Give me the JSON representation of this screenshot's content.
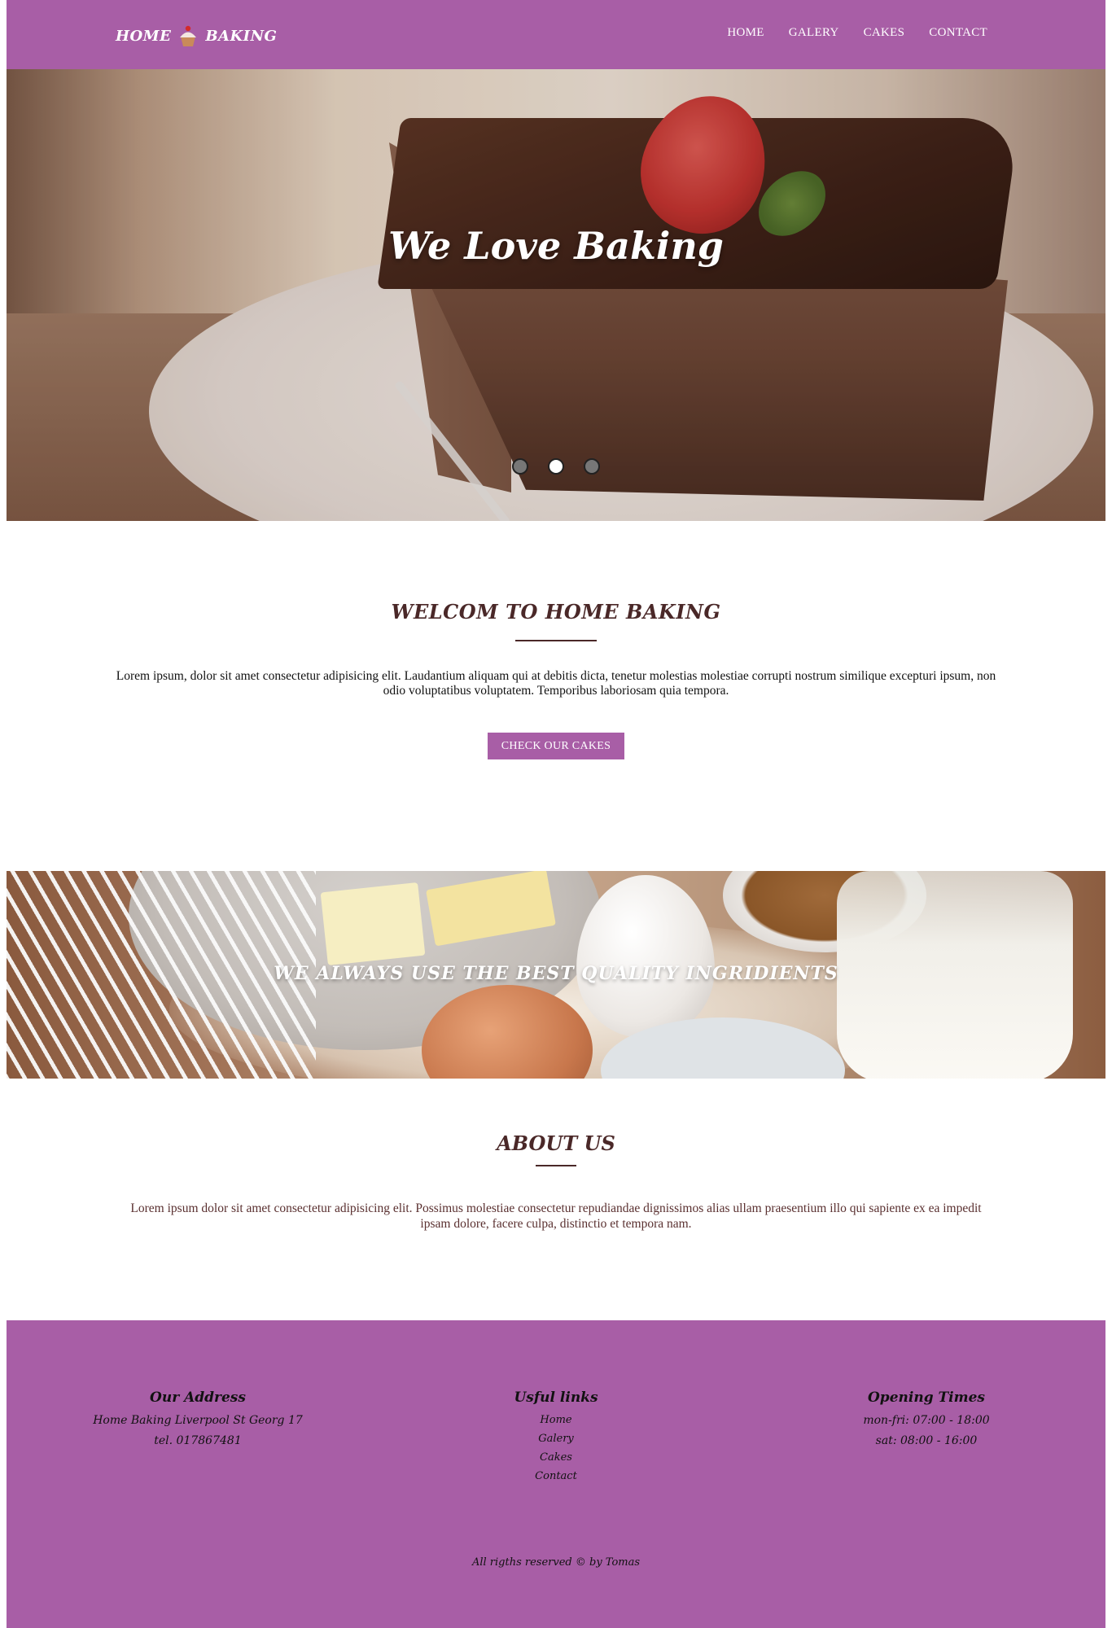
{
  "nav": {
    "logo_left": "HOME",
    "logo_right": "BAKING",
    "links": [
      "HOME",
      "GALERY",
      "CAKES",
      "CONTACT"
    ]
  },
  "hero": {
    "title": "We Love Baking",
    "slides_total": 3,
    "active_slide": 2
  },
  "welcome": {
    "title": "WELCOM TO HOME BAKING",
    "text": "Lorem ipsum, dolor sit amet consectetur adipisicing elit. Laudantium aliquam qui at debitis dicta, tenetur molestias molestiae corrupti nostrum similique excepturi ipsum, non odio voluptatibus voluptatem. Temporibus laboriosam quia tempora.",
    "button": "CHECK OUR CAKES"
  },
  "banner": {
    "title": "WE ALWAYS USE THE BEST QUALITY INGRIDIENTS"
  },
  "about": {
    "title": "ABOUT US",
    "text": "Lorem ipsum dolor sit amet consectetur adipisicing elit. Possimus molestiae consectetur repudiandae dignissimos alias ullam praesentium illo qui sapiente ex ea impedit ipsam dolore, facere culpa, distinctio et tempora nam."
  },
  "footer": {
    "address": {
      "title": "Our Address",
      "line1": "Home Baking Liverpool St Georg 17",
      "line2": "tel. 017867481"
    },
    "links": {
      "title": "Usful links",
      "items": [
        "Home",
        "Galery",
        "Cakes",
        "Contact"
      ]
    },
    "hours": {
      "title": "Opening Times",
      "line1": "mon-fri: 07:00 - 18:00",
      "line2": "sat: 08:00 - 16:00"
    },
    "copyright": "All rigths reserved © by Tomas"
  },
  "colors": {
    "brand": "#a85ea6",
    "heading": "#4a2828"
  },
  "icons": {
    "logo": "cupcake-icon"
  }
}
